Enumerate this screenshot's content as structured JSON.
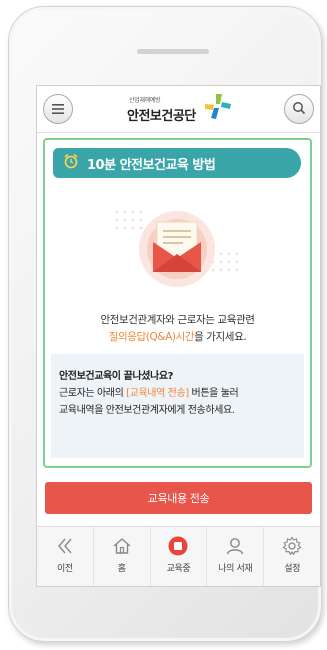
{
  "header": {
    "logo_sub": "산업재해예방",
    "logo_main": "안전보건공단"
  },
  "content": {
    "title": "10분 안전보건교육 방법",
    "message_line1": "안전보건관계자와 근로자는 교육관련",
    "message_line2_highlight": "질의응답(Q&A)시간",
    "message_line2_rest": "을 가지세요.",
    "notice": {
      "line1": "안전보건교육이 끝나셨나요?",
      "line2_pre": "근로자는 아래의 ",
      "line2_highlight": "[교육내역 전송]",
      "line2_post": " 버튼을 눌러",
      "line3": "교육내역을 안전보건관계자에게 전송하세요."
    }
  },
  "send_button": {
    "label": "교육내용 전송"
  },
  "bottom_nav": {
    "items": [
      {
        "label": "이전",
        "icon": "chevron-double-left-icon"
      },
      {
        "label": "홈",
        "icon": "home-icon"
      },
      {
        "label": "교육중",
        "icon": "stop-icon"
      },
      {
        "label": "나의 서재",
        "icon": "person-icon"
      },
      {
        "label": "설정",
        "icon": "gear-icon"
      }
    ]
  },
  "colors": {
    "title_bar": "#3aa5a8",
    "send_button": "#e8554b",
    "highlight": "#f0873b",
    "content_border": "#7fcf8f"
  }
}
